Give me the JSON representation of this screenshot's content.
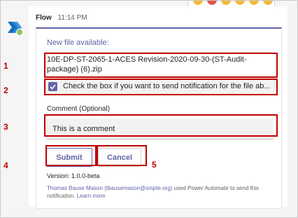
{
  "message": {
    "sender": "Flow",
    "time": "11:14 PM"
  },
  "card": {
    "title": "New file available:",
    "filename": "10E-DP-ST-2065-1-ACES Revision-2020-09-30-(ST-Audit-package) (6).zip",
    "checkbox_label": "Check the box if you want to send notification for the file ab...",
    "checkbox_checked": true,
    "comment_label": "Comment (Optional)",
    "comment_value": "This is a comment",
    "submit_label": "Submit",
    "cancel_label": "Cancel",
    "version": "Version: 1.0.0-beta",
    "footer_user": "Thomas Bause Mason (tbausemason@smpte.org)",
    "footer_text": " used Power Automate to send this notification. ",
    "footer_link": "Learn more"
  },
  "annotations": {
    "n1": "1",
    "n2": "2",
    "n3": "3",
    "n4": "4",
    "n5": "5"
  },
  "colors": {
    "accent": "#6264a7",
    "annotation": "#c00000",
    "avatar_bg": "#0f6cbd"
  },
  "icons": {
    "avatar": "power-automate-icon",
    "checkbox": "checkmark-icon"
  }
}
